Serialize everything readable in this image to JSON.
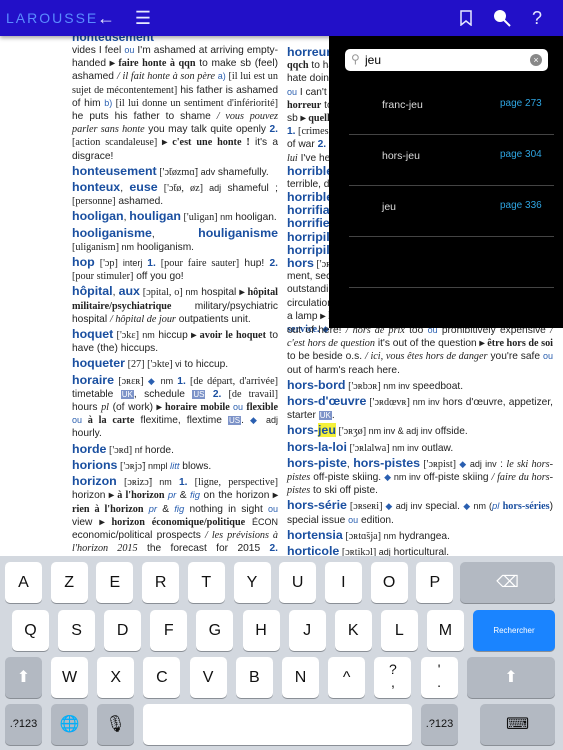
{
  "app": {
    "logo": "LAROUSSE",
    "accent": "#2210c8"
  },
  "toolbar": {
    "back_icon": "arrow-left-icon",
    "toc_icon": "list-icon",
    "bookmark_icon": "bookmark-icon",
    "search_icon": "search-icon",
    "help_label": "?"
  },
  "page": {
    "cut_headword": "honteusement",
    "left": [
      [
        [
          "tr",
          "vides I feel "
        ],
        [
          "ou",
          "ou"
        ],
        [
          "tr",
          " I'm ashamed at arriving empty-handed "
        ],
        [
          "b",
          "▸ faire honte à qqn"
        ],
        [
          "tr",
          " to make sb (feel) ashamed "
        ],
        [
          "i",
          "/ il fait honte à son père"
        ],
        [
          "ou",
          " a)"
        ],
        [
          "br",
          " [il lui est un sujet de mécontentement]"
        ],
        [
          "tr",
          " his father is ashamed of him "
        ],
        [
          "ou",
          "b)"
        ],
        [
          "br",
          " [il lui donne un sentiment d'infériorité]"
        ],
        [
          "tr",
          " he puts his father to shame "
        ],
        [
          "i",
          "/ vous pouvez parler sans honte"
        ],
        [
          "tr",
          " you may talk quite openly "
        ],
        [
          "n",
          "2."
        ],
        [
          "br",
          " [action scandaleuse] "
        ],
        [
          "b",
          "▸ c'est une honte !"
        ],
        [
          "tr",
          " it's a disgrace!"
        ]
      ],
      [
        [
          "hw",
          "honteusement"
        ],
        [
          "ph",
          " ['ɔ̃tøzmɑ̃]"
        ],
        [
          "g",
          " adv"
        ],
        [
          "tr",
          " shamefully."
        ]
      ],
      [
        [
          "hw",
          "honteux"
        ],
        [
          "tr",
          ", "
        ],
        [
          "hw",
          "euse"
        ],
        [
          "ph",
          " ['ɔ̃tø, øz]"
        ],
        [
          "g",
          " adj"
        ],
        [
          "tr",
          " shameful ; "
        ],
        [
          "br",
          "[personne]"
        ],
        [
          "tr",
          " ashamed."
        ]
      ],
      [
        [
          "hw",
          "hooligan"
        ],
        [
          "tr",
          ", "
        ],
        [
          "hw",
          "houligan"
        ],
        [
          "ph",
          " ['uligan]"
        ],
        [
          "g",
          " nm"
        ],
        [
          "tr",
          " hooligan."
        ]
      ],
      [
        [
          "hw",
          "hooliganisme"
        ],
        [
          "tr",
          ", "
        ],
        [
          "hw",
          "houliganisme"
        ],
        [
          "ph",
          " [uliganism]"
        ],
        [
          "g",
          " nm"
        ],
        [
          "tr",
          " hooliganism."
        ]
      ],
      [
        [
          "hw",
          "hop"
        ],
        [
          "ph",
          " ['ɔp]"
        ],
        [
          "g",
          " interj "
        ],
        [
          "n",
          "1."
        ],
        [
          "br",
          " [pour faire sauter]"
        ],
        [
          "tr",
          " hup! "
        ],
        [
          "n",
          "2."
        ],
        [
          "br",
          " [pour stimuler]"
        ],
        [
          "tr",
          " off you go!"
        ]
      ],
      [
        [
          "hw",
          "hôpital"
        ],
        [
          "tr",
          ", "
        ],
        [
          "hw",
          "aux"
        ],
        [
          "ph",
          " [ɔpital, o]"
        ],
        [
          "g",
          " nm"
        ],
        [
          "tr",
          " hospital "
        ],
        [
          "b",
          "▸ hôpital militaire/psychiatrique"
        ],
        [
          "tr",
          " military/psychiatric hospital "
        ],
        [
          "i",
          "/ hôpital de jour"
        ],
        [
          "tr",
          " outpatients unit."
        ]
      ],
      [
        [
          "hw",
          "hoquet"
        ],
        [
          "ph",
          " ['ɔkɛ]"
        ],
        [
          "g",
          " nm"
        ],
        [
          "tr",
          " hiccup "
        ],
        [
          "b",
          "▸ avoir le hoquet"
        ],
        [
          "tr",
          " to have (the) hiccups."
        ]
      ],
      [
        [
          "hw",
          "hoqueter"
        ],
        [
          "ph",
          " [27] ['ɔkte]"
        ],
        [
          "g",
          " vi"
        ],
        [
          "tr",
          " to hiccup."
        ]
      ],
      [
        [
          "hw",
          "horaire"
        ],
        [
          "ph",
          " [ɔʀɛʀ]"
        ],
        [
          "ou",
          " ◆ "
        ],
        [
          "g",
          "nm "
        ],
        [
          "n",
          "1."
        ],
        [
          "br",
          " [de départ, d'arrivée]"
        ],
        [
          "tr",
          " timetable "
        ],
        [
          "lab",
          "UK"
        ],
        [
          "tr",
          ", schedule "
        ],
        [
          "lab",
          "US"
        ],
        [
          "n",
          " 2."
        ],
        [
          "br",
          " [de travail]"
        ],
        [
          "tr",
          " hours "
        ],
        [
          "i",
          "pl"
        ],
        [
          "tr",
          " (of work) "
        ],
        [
          "b",
          "▸ horaire mobile"
        ],
        [
          "ou",
          " ou "
        ],
        [
          "b",
          "flexible"
        ],
        [
          "ou",
          " ou "
        ],
        [
          "b",
          "à la carte"
        ],
        [
          "tr",
          " flexitime, flextime "
        ],
        [
          "lab",
          "US"
        ],
        [
          "tr",
          ". "
        ],
        [
          "ou",
          "◆"
        ],
        [
          "g",
          " adj"
        ],
        [
          "tr",
          " hourly."
        ]
      ],
      [
        [
          "hw",
          "horde"
        ],
        [
          "ph",
          " ['ɔʀd]"
        ],
        [
          "g",
          " nf"
        ],
        [
          "tr",
          " horde."
        ]
      ],
      [
        [
          "hw",
          "horions"
        ],
        [
          "ph",
          " ['ɔʀjɔ̃]"
        ],
        [
          "g",
          " nmpl "
        ],
        [
          "it",
          "litt"
        ],
        [
          "tr",
          " blows."
        ]
      ],
      [
        [
          "hw",
          "horizon"
        ],
        [
          "ph",
          " [ɔʀizɔ̃]"
        ],
        [
          "g",
          " nm "
        ],
        [
          "n",
          "1."
        ],
        [
          "br",
          " [ligne, perspective]"
        ],
        [
          "tr",
          " horizon "
        ],
        [
          "b",
          "▸ à l'horizon"
        ],
        [
          "it",
          " pr"
        ],
        [
          "tr",
          " & "
        ],
        [
          "it",
          "fig"
        ],
        [
          "tr",
          " on the horizon "
        ],
        [
          "b",
          "▸ rien à l'horizon"
        ],
        [
          "it",
          " pr"
        ],
        [
          "tr",
          " & "
        ],
        [
          "it",
          "fig"
        ],
        [
          "tr",
          " nothing in sight "
        ],
        [
          "ou",
          "ou"
        ],
        [
          "tr",
          " view "
        ],
        [
          "b",
          "▸ horizon économique/politique"
        ],
        [
          "g",
          " ÉCON"
        ],
        [
          "tr",
          " economic/political prospects "
        ],
        [
          "i",
          "/ les prévisions à l'horizon 2015"
        ],
        [
          "tr",
          " the forecast for 2015 "
        ],
        [
          "n",
          "2."
        ],
        [
          "br",
          " [panorama]"
        ],
        [
          "tr",
          " view "
        ],
        [
          "i",
          "/ changer d'horizon"
        ],
        [
          "tr",
          " to have a change of scene "
        ],
        [
          "ou",
          "ou"
        ],
        [
          "tr",
          " scenery."
        ]
      ],
      [
        [
          "hw",
          "horizontal"
        ],
        [
          "tr",
          ", "
        ],
        [
          "hw",
          "e"
        ],
        [
          "tr",
          ", "
        ],
        [
          "hw",
          "aux"
        ],
        [
          "ph",
          " [ɔʀizɔ̃tal, o]"
        ],
        [
          "g",
          " adj"
        ],
        [
          "tr",
          " horizontal. "
        ],
        [
          "hw",
          "◆ horizontale"
        ],
        [
          "g",
          " nf MATH"
        ],
        [
          "tr",
          " horizontal "
        ],
        [
          "b",
          "▸ à l'horizontale"
        ],
        [
          "ou",
          " a)"
        ],
        [
          "tr",
          " horizontal, in a horizontal position "
        ],
        [
          "ou",
          "b)"
        ],
        [
          "br",
          " [couché]"
        ],
        [
          "tr",
          " flat out."
        ]
      ],
      [
        [
          "hw",
          "horizontalement"
        ],
        [
          "ph",
          " [ɔʀizɔ̃talmɑ̃]"
        ],
        [
          "g",
          " adv"
        ],
        [
          "tr",
          " horizontally."
        ]
      ],
      [
        [
          "hw",
          "horloge"
        ],
        [
          "ph",
          " [ɔʀlɔʒ]"
        ],
        [
          "g",
          " nf"
        ],
        [
          "tr",
          " clock "
        ],
        [
          "b",
          "▸ horloge parlante"
        ],
        [
          "tr",
          " speaking clock "
        ],
        [
          "lab",
          "UK"
        ],
        [
          "tr",
          ", Time "
        ],
        [
          "lab",
          "US"
        ],
        [
          "tr",
          "."
        ]
      ]
    ],
    "right_top": [
      [
        [
          "hw",
          "horreur"
        ]
      ],
      [
        [
          "b",
          "qqch"
        ],
        [
          "tr",
          " to ha"
        ]
      ],
      [
        [
          "tr",
          "hate doing"
        ]
      ],
      [
        [
          "ou",
          "ou"
        ],
        [
          "tr",
          " I can't s"
        ]
      ],
      [
        [
          "b",
          "horreur"
        ],
        [
          "tr",
          " to"
        ]
      ],
      [
        [
          "tr",
          "sb "
        ],
        [
          "b",
          "▸ quelle"
        ]
      ],
      [
        [
          "n",
          "1."
        ],
        [
          "br",
          " [crimes]"
        ]
      ],
      [
        [
          "tr",
          "of war "
        ],
        [
          "n",
          "2."
        ],
        [
          "br",
          " [c"
        ]
      ],
      [
        [
          "i",
          "lui"
        ],
        [
          "tr",
          " I've hea"
        ]
      ],
      [
        [
          "hw",
          "horrible"
        ]
      ],
      [
        [
          "tr",
          "terrible, dre"
        ]
      ],
      [
        [
          "hw",
          "horrible"
        ]
      ],
      [
        [
          "hw",
          "horrifiar"
        ]
      ],
      [
        [
          "hw",
          "horrifier"
        ]
      ],
      [
        [
          "hw",
          "horripila"
        ]
      ],
      [
        [
          "hw",
          "horripile"
        ]
      ],
      [
        [
          "hw",
          "hors"
        ],
        [
          "ph",
          " ['ɔʀ]"
        ]
      ],
      [
        [
          "tr",
          "ment, secon"
        ]
      ],
      [
        [
          "tr",
          "outstanding"
        ]
      ],
      [
        [
          "tr",
          "circulation "
        ],
        [
          "i",
          "/"
        ]
      ],
      [
        [
          "tr",
          "a lamp "
        ],
        [
          "b",
          "▸ ho"
        ]
      ],
      [
        [
          "bserif",
          "service. "
        ],
        [
          "ou",
          "◆"
        ]
      ]
    ],
    "right": [
      [
        [
          "tr",
          "out of here! "
        ],
        [
          "i",
          "/ hors de prix"
        ],
        [
          "tr",
          " too "
        ],
        [
          "ou",
          "ou"
        ],
        [
          "tr",
          " prohibitively expensive "
        ],
        [
          "i",
          "/ c'est hors de question"
        ],
        [
          "tr",
          " it's out of the question "
        ],
        [
          "b",
          "▸ être hors de soi"
        ],
        [
          "tr",
          " to be beside o.s. "
        ],
        [
          "i",
          "/ ici, vous êtes hors de danger"
        ],
        [
          "tr",
          " you're safe "
        ],
        [
          "ou",
          "ou"
        ],
        [
          "tr",
          " out of harm's reach here."
        ]
      ],
      [
        [
          "hw",
          "hors-bord"
        ],
        [
          "ph",
          " ['ɔʀbɔʀ]"
        ],
        [
          "g",
          " nm inv"
        ],
        [
          "tr",
          " speedboat."
        ]
      ],
      [
        [
          "hw",
          "hors-d'œuvre"
        ],
        [
          "ph",
          " ['ɔʀdœvʀ]"
        ],
        [
          "g",
          " nm inv"
        ],
        [
          "tr",
          " hors d'œuvre, appetizer, starter "
        ],
        [
          "lab",
          "UK"
        ],
        [
          "tr",
          "."
        ]
      ],
      [
        [
          "hw",
          "hors-"
        ],
        [
          "hwhl",
          "jeu"
        ],
        [
          "ph",
          " ['ɔʀʒø]"
        ],
        [
          "g",
          " nm inv & adj inv"
        ],
        [
          "tr",
          " offside."
        ]
      ],
      [
        [
          "hw",
          "hors-la-loi"
        ],
        [
          "ph",
          " ['ɔʀlalwa]"
        ],
        [
          "g",
          " nm inv"
        ],
        [
          "tr",
          " outlaw."
        ]
      ],
      [
        [
          "hw",
          "hors-piste"
        ],
        [
          "tr",
          ", "
        ],
        [
          "hw",
          "hors-pistes"
        ],
        [
          "ph",
          " ['ɔʀpist]"
        ],
        [
          "ou",
          " ◆ "
        ],
        [
          "g",
          "adj inv"
        ],
        [
          "tr",
          " : "
        ],
        [
          "i",
          "le ski hors-pistes"
        ],
        [
          "tr",
          " off-piste skiing. "
        ],
        [
          "ou",
          "◆ "
        ],
        [
          "g",
          "nm inv"
        ],
        [
          "tr",
          " off-piste skiing "
        ],
        [
          "i",
          "/ faire du hors-pistes"
        ],
        [
          "tr",
          " to ski off piste."
        ]
      ],
      [
        [
          "hw",
          "hors-série"
        ],
        [
          "ph",
          " [ɔʀseʀi]"
        ],
        [
          "ou",
          " ◆ "
        ],
        [
          "g",
          "adj inv"
        ],
        [
          "tr",
          " special. "
        ],
        [
          "ou",
          "◆ "
        ],
        [
          "g",
          "nm ("
        ],
        [
          "it",
          "pl"
        ],
        [
          "tr",
          " "
        ],
        [
          "bserif",
          "hors-séries"
        ],
        [
          "tr",
          ") special issue "
        ],
        [
          "ou",
          "ou"
        ],
        [
          "tr",
          " edition."
        ]
      ],
      [
        [
          "hw",
          "hortensia"
        ],
        [
          "ph",
          " [ɔʀtɑ̃sja]"
        ],
        [
          "g",
          " nm"
        ],
        [
          "tr",
          " hydrangea."
        ]
      ],
      [
        [
          "hw",
          "horticole"
        ],
        [
          "ph",
          " [ɔʀtikɔl]"
        ],
        [
          "g",
          " adj"
        ],
        [
          "tr",
          " horticultural."
        ]
      ],
      [
        [
          "hw",
          "horticulteur"
        ],
        [
          "tr",
          ", "
        ],
        [
          "hw",
          "trice"
        ],
        [
          "ph",
          " [ɔʀtikyltœʀ, tʀis]"
        ],
        [
          "g",
          " nm, f"
        ],
        [
          "tr",
          " horticulturalist."
        ]
      ]
    ]
  },
  "search": {
    "value": "jeu",
    "results": [
      {
        "word": "franc-jeu",
        "page": "page 273"
      },
      {
        "word": "hors-jeu",
        "page": "page 304"
      },
      {
        "word": "jeu",
        "page": "page 336"
      }
    ]
  },
  "keyboard": {
    "row1": [
      "A",
      "Z",
      "E",
      "R",
      "T",
      "Y",
      "U",
      "I",
      "O",
      "P"
    ],
    "row2": [
      "Q",
      "S",
      "D",
      "F",
      "G",
      "H",
      "J",
      "K",
      "L",
      "M"
    ],
    "row3": [
      "W",
      "X",
      "C",
      "V",
      "B",
      "N",
      "^",
      "?\n,",
      "'\n."
    ],
    "search_label": "Rechercher",
    "numbers_label": ".?123",
    "search_key_color": "#1a84ff"
  }
}
